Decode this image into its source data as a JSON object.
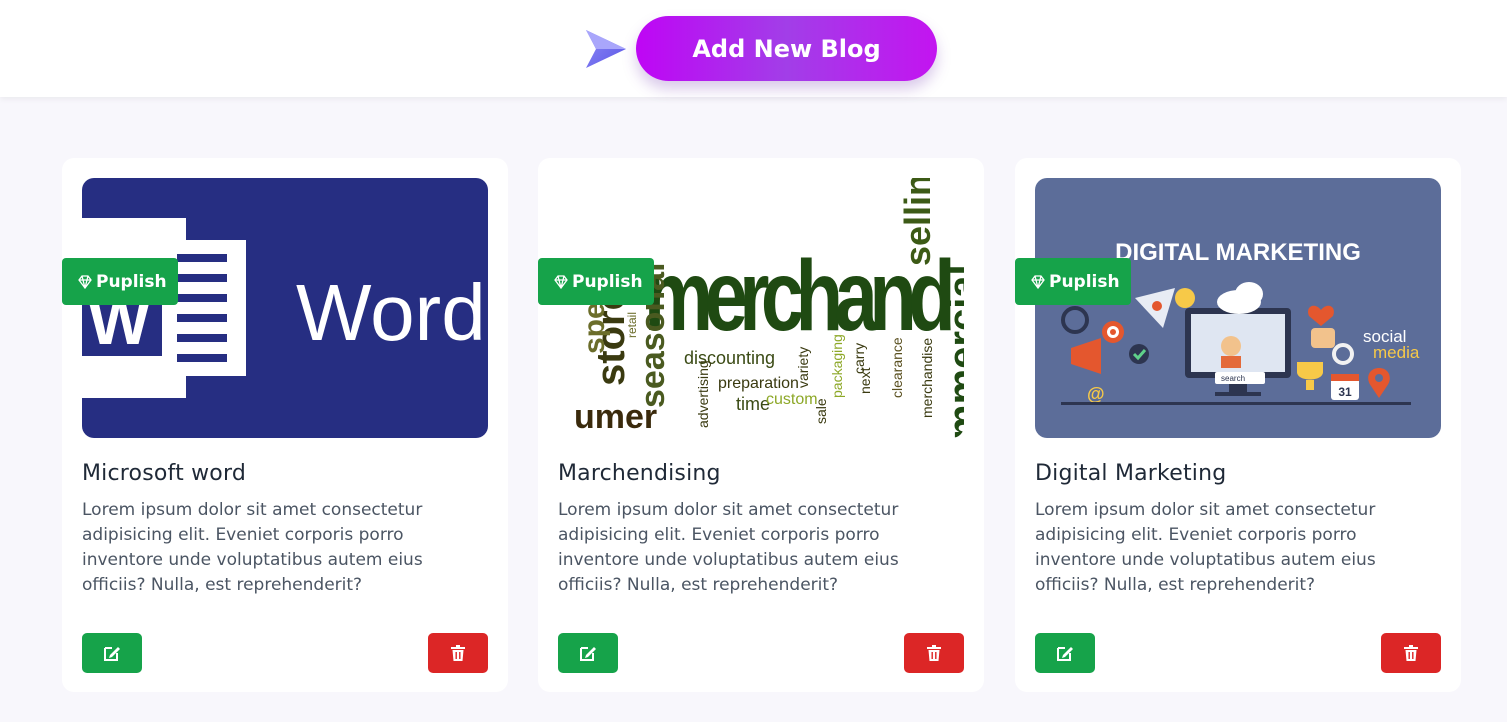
{
  "header": {
    "add_button_label": "Add New Blog",
    "icon": "send-arrow-icon"
  },
  "cards": [
    {
      "title": "Microsoft word",
      "description": "Lorem ipsum dolor sit amet consectetur adipisicing elit. Eveniet corporis porro inventore unde voluptatibus autem eius officiis? Nulla, est reprehenderit?",
      "badge": "Puplish",
      "image_text": "Word"
    },
    {
      "title": "Marchendising",
      "description": "Lorem ipsum dolor sit amet consectetur adipisicing elit. Eveniet corporis porro inventore unde voluptatibus autem eius officiis? Nulla, est reprehenderit?",
      "badge": "Puplish",
      "image_words": [
        "merchand",
        "selling",
        "store",
        "seasonal",
        "discounting",
        "advertising",
        "preparation",
        "time",
        "custom",
        "variety",
        "packaging",
        "next",
        "carry",
        "clearance",
        "merchandise",
        "sale",
        "umer",
        "mmercial",
        "spend",
        "retail"
      ]
    },
    {
      "title": "Digital Marketing",
      "description": "Lorem ipsum dolor sit amet consectetur adipisicing elit. Eveniet corporis porro inventore unde voluptatibus autem eius officiis? Nulla, est reprehenderit?",
      "badge": "Puplish",
      "image_words": [
        "DIGITAL MARKETING",
        "social",
        "media",
        "search",
        "31"
      ]
    }
  ],
  "colors": {
    "publish_green": "#16a34a",
    "delete_red": "#dc2626",
    "button_purple": "#bf05f5",
    "word_blue": "#262e82",
    "digital_bg": "#5c6d99"
  },
  "icons": {
    "badge": "gem-icon",
    "edit": "edit-icon",
    "delete": "trash-icon"
  }
}
